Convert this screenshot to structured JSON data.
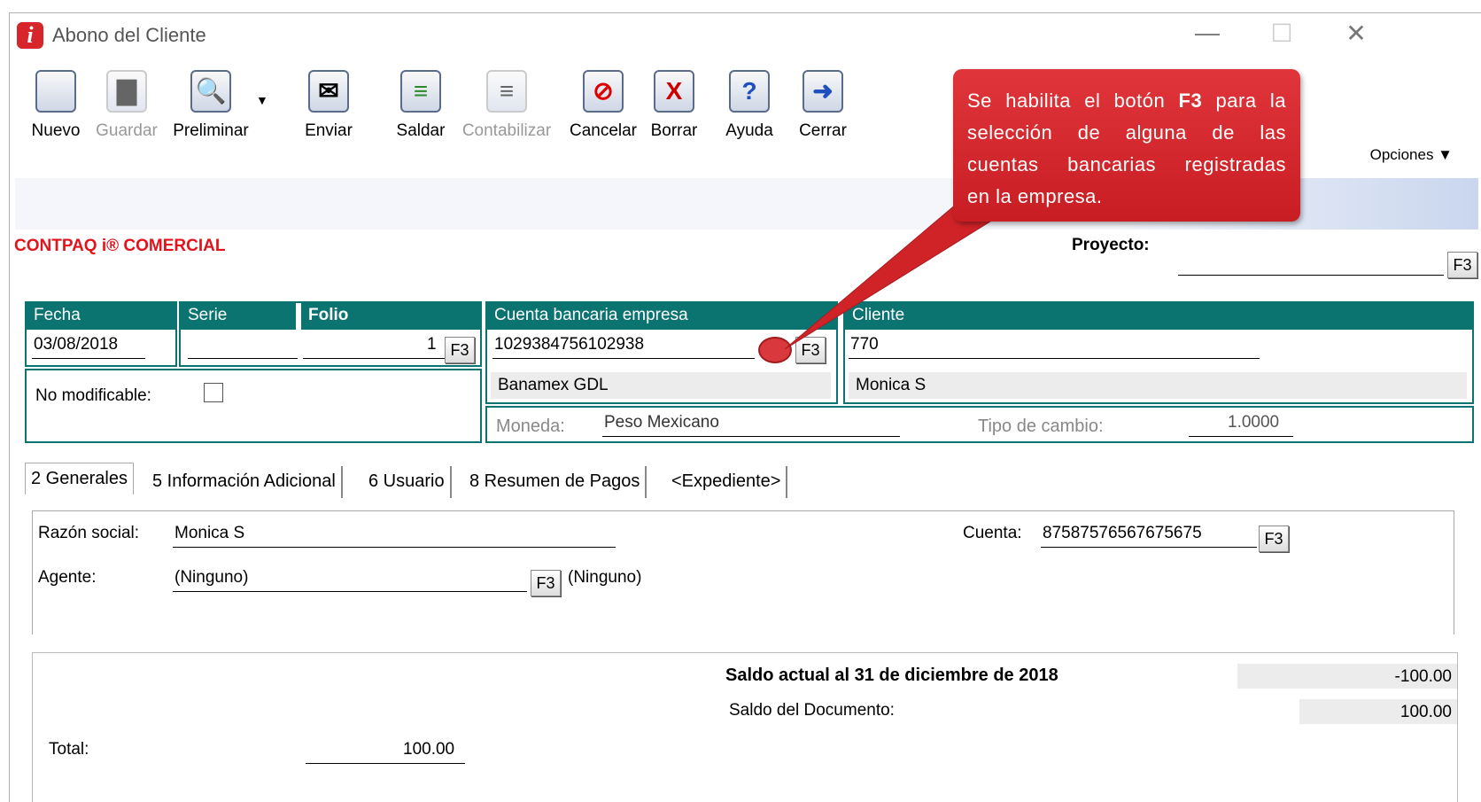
{
  "window": {
    "title": "Abono del Cliente",
    "minimize": "—",
    "maximize": "☐",
    "close": "✕"
  },
  "toolbar": {
    "nuevo": "Nuevo",
    "guardar": "Guardar",
    "preliminar": "Preliminar",
    "enviar": "Enviar",
    "saldar": "Saldar",
    "contabilizar": "Contabilizar",
    "cancelar": "Cancelar",
    "borrar": "Borrar",
    "ayuda": "Ayuda",
    "cerrar": "Cerrar",
    "opciones": "Opciones ▼",
    "dropdown": "▼"
  },
  "brand": "CONTPAQ i® COMERCIAL",
  "proyecto": {
    "label": "Proyecto:",
    "value": "",
    "f3": "F3"
  },
  "header": {
    "fecha_label": "Fecha",
    "fecha_value": "03/08/2018",
    "serie_label": "Serie",
    "serie_value": "",
    "folio_label": "Folio",
    "folio_value": "1",
    "folio_f3": "F3",
    "no_modificable": "No modificable:",
    "cuenta_label": "Cuenta bancaria empresa",
    "cuenta_value": "1029384756102938",
    "cuenta_f3": "F3",
    "banco": "Banamex GDL",
    "cliente_label": "Cliente",
    "cliente_value": "770",
    "cliente_nombre": "Monica S",
    "moneda_label": "Moneda:",
    "moneda_value": "Peso Mexicano",
    "tipo_cambio_label": "Tipo de cambio:",
    "tipo_cambio_value": "1.0000"
  },
  "tabs": [
    "2 Generales",
    "5 Información Adicional",
    "6 Usuario",
    "8 Resumen de Pagos",
    "<Expediente>"
  ],
  "generales": {
    "razon_label": "Razón social:",
    "razon_value": "Monica S",
    "cuenta_label": "Cuenta:",
    "cuenta_value": "87587576567675675",
    "cuenta_f3": "F3",
    "agente_label": "Agente:",
    "agente_value": "(Ninguno)",
    "agente_f3": "F3",
    "agente_desc": "(Ninguno)"
  },
  "totales": {
    "saldo_actual_label": "Saldo actual al 31 de diciembre de 2018",
    "saldo_actual_value": "-100.00",
    "saldo_doc_label": "Saldo del Documento:",
    "saldo_doc_value": "100.00",
    "total_label": "Total:",
    "total_value": "100.00"
  },
  "callout": {
    "line1_a": "Se habilita el botón ",
    "line1_b": "F3",
    "line1_c": " para la",
    "line2": "selección de alguna de las",
    "line3": "cuentas bancarias registradas",
    "line4": "en la empresa."
  },
  "colors": {
    "teal": "#0b7370",
    "brand_red": "#e0141c",
    "callout_red": "#d32a2f"
  }
}
